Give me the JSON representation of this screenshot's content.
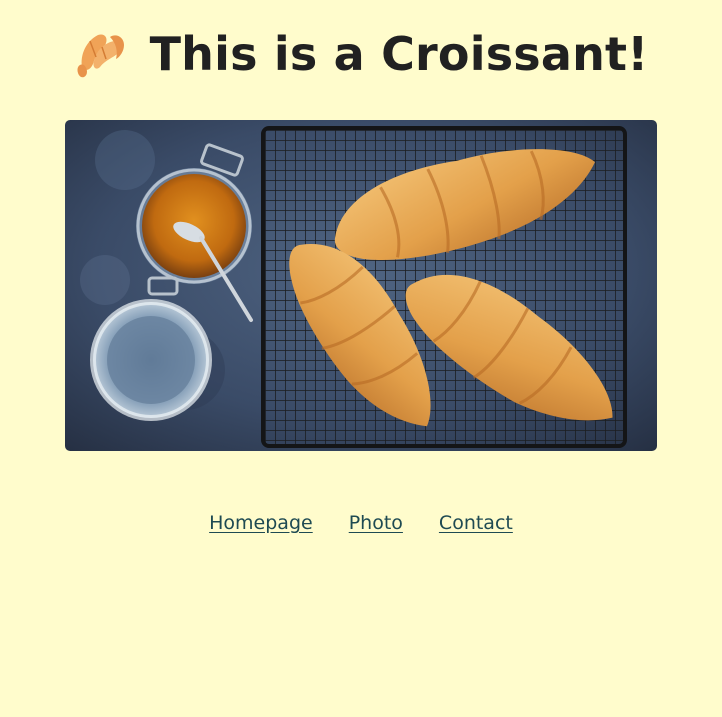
{
  "header": {
    "title": "This is a Croissant!",
    "logo_icon": "croissant-icon",
    "logo_color": "#f2a65a"
  },
  "photo": {
    "subject_icon": "croissant-photo"
  },
  "nav": {
    "links": [
      {
        "label": "Homepage"
      },
      {
        "label": "Photo"
      },
      {
        "label": "Contact"
      }
    ]
  },
  "colors": {
    "background": "#fffccc",
    "text": "#212121",
    "link": "#1e4a52"
  }
}
